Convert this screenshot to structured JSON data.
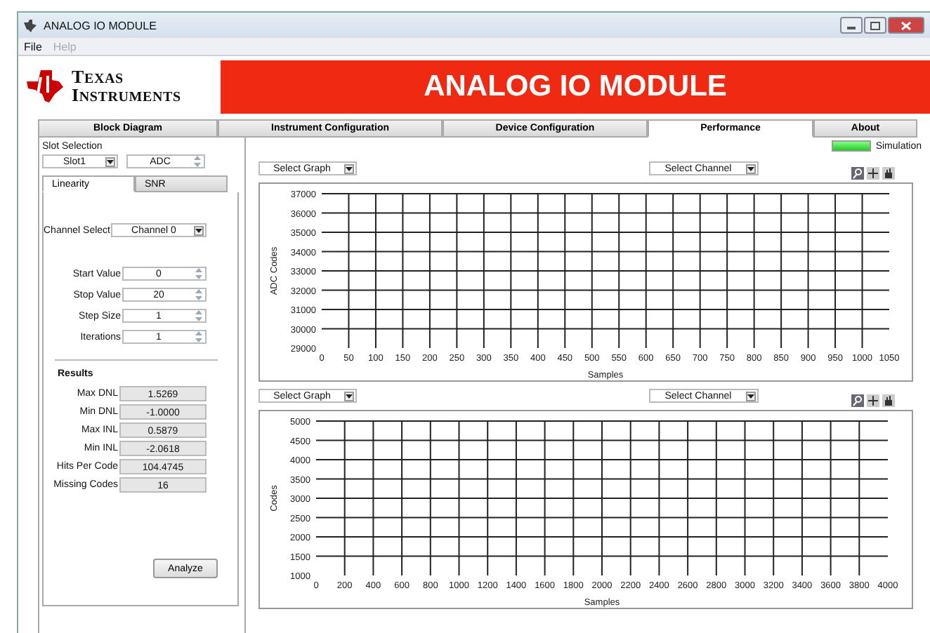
{
  "window": {
    "title": "ANALOG IO MODULE"
  },
  "menu": [
    {
      "label": "File",
      "disabled": false
    },
    {
      "label": "Help",
      "disabled": true
    }
  ],
  "header": {
    "logo_lines": [
      "TEXAS",
      "INSTRUMENTS"
    ],
    "title": "ANALOG IO MODULE"
  },
  "tabs": [
    {
      "label": "Block Diagram",
      "selected": false
    },
    {
      "label": "Instrument Configuration",
      "selected": false
    },
    {
      "label": "Device Configuration",
      "selected": false
    },
    {
      "label": "Performance",
      "selected": true
    },
    {
      "label": "About",
      "selected": false
    }
  ],
  "slot_selection": {
    "label": "Slot Selection",
    "slot": "Slot1",
    "type": "ADC"
  },
  "subtabs": [
    {
      "label": "Linearity",
      "selected": true
    },
    {
      "label": "SNR",
      "selected": false
    }
  ],
  "channel_select": {
    "label": "Channel Select",
    "value": "Channel 0"
  },
  "parameters": [
    {
      "label": "Start Value",
      "value": "0"
    },
    {
      "label": "Stop Value",
      "value": "20"
    },
    {
      "label": "Step Size",
      "value": "1"
    },
    {
      "label": "Iterations",
      "value": "1"
    }
  ],
  "results": {
    "heading": "Results",
    "items": [
      {
        "label": "Max DNL",
        "value": "1.5269"
      },
      {
        "label": "Min DNL",
        "value": "-1.0000"
      },
      {
        "label": "Max INL",
        "value": "0.5879"
      },
      {
        "label": "Min INL",
        "value": "-2.0618"
      },
      {
        "label": "Hits Per Code",
        "value": "104.4745"
      },
      {
        "label": "Missing Codes",
        "value": "16"
      }
    ]
  },
  "analyze_button": "Analyze",
  "simulation": {
    "label": "Simulation",
    "on": true
  },
  "graphs": [
    {
      "graph_select": "Select Graph",
      "channel_select": "Select Channel",
      "chart_data": {
        "type": "line",
        "grid": true,
        "xlabel": "Samples",
        "ylabel": "ADC Codes",
        "xlim": [
          0,
          1050
        ],
        "ylim": [
          29000,
          37000
        ],
        "xticks": [
          0,
          50,
          100,
          150,
          200,
          250,
          300,
          350,
          400,
          450,
          500,
          550,
          600,
          650,
          700,
          750,
          800,
          850,
          900,
          950,
          1000,
          1050
        ],
        "yticks": [
          29000,
          30000,
          31000,
          32000,
          33000,
          34000,
          35000,
          36000,
          37000
        ]
      }
    },
    {
      "graph_select": "Select Graph",
      "channel_select": "Select Channel",
      "chart_data": {
        "type": "line",
        "grid": true,
        "xlabel": "Samples",
        "ylabel": "Codes",
        "xlim": [
          0,
          4000
        ],
        "ylim": [
          1000,
          5000
        ],
        "xticks": [
          0,
          200,
          400,
          600,
          800,
          1000,
          1200,
          1400,
          1600,
          1800,
          2000,
          2200,
          2400,
          2600,
          2800,
          3000,
          3200,
          3400,
          3600,
          3800,
          4000
        ],
        "yticks": [
          1000,
          1500,
          2000,
          2500,
          3000,
          3500,
          4000,
          4500,
          5000
        ]
      }
    }
  ]
}
